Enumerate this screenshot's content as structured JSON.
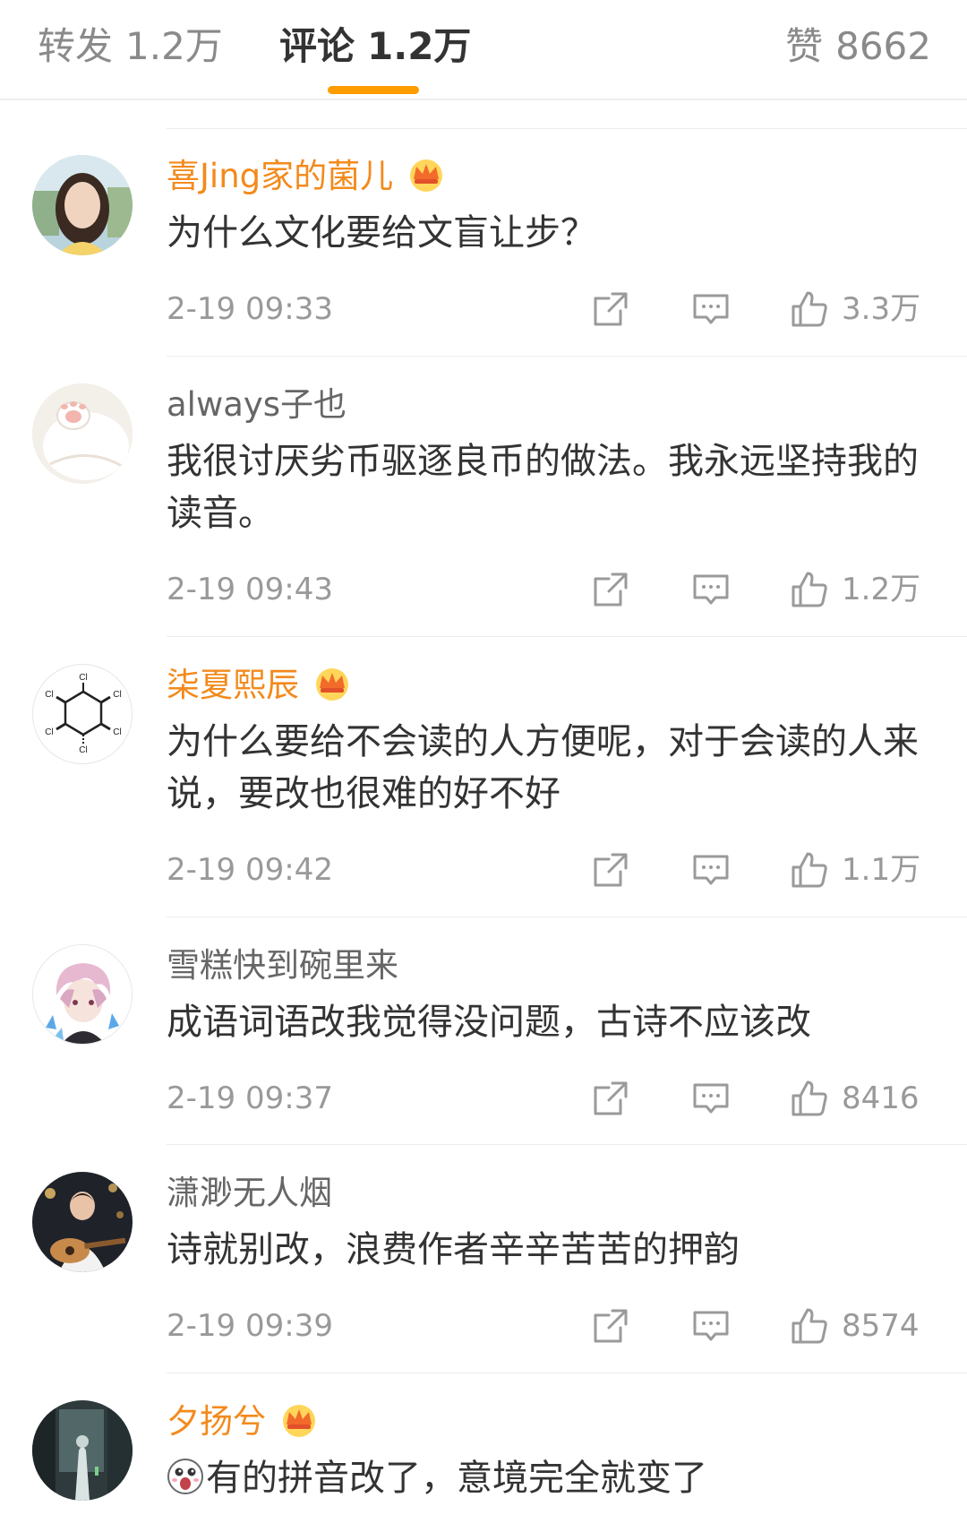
{
  "tabs": {
    "repost": {
      "label": "转发",
      "count": "1.2万"
    },
    "comment": {
      "label": "评论",
      "count": "1.2万"
    },
    "like": {
      "label": "赞",
      "count": "8662"
    }
  },
  "colors": {
    "accent": "#ff9c00",
    "vip_name": "#f38a1c",
    "meta_text": "#999999"
  },
  "comments": [
    {
      "username": "喜Jing家的菌儿",
      "vip": true,
      "text": "为什么文化要给文盲让步？",
      "time": "2-19 09:33",
      "likes": "3.3万",
      "avatar_icon": "avatar-woman-photo"
    },
    {
      "username": "always子也",
      "vip": false,
      "text": "我很讨厌劣币驱逐良币的做法。我永远坚持我的读音。",
      "time": "2-19 09:43",
      "likes": "1.2万",
      "avatar_icon": "avatar-cat-paw"
    },
    {
      "username": "柒夏熙辰",
      "vip": true,
      "text": "为什么要给不会读的人方便呢，对于会读的人来说，要改也很难的好不好",
      "time": "2-19 09:42",
      "likes": "1.1万",
      "avatar_icon": "avatar-chemical-structure"
    },
    {
      "username": "雪糕快到碗里来",
      "vip": false,
      "text": "成语词语改我觉得没问题，古诗不应该改",
      "time": "2-19 09:37",
      "likes": "8416",
      "avatar_icon": "avatar-anime-character"
    },
    {
      "username": "潇渺无人烟",
      "vip": false,
      "text": "诗就别改，浪费作者辛辛苦苦的押韵",
      "time": "2-19 09:39",
      "likes": "8574",
      "avatar_icon": "avatar-guitar-player"
    },
    {
      "username": "夕扬兮",
      "vip": true,
      "text": "有的拼音改了，意境完全就变了",
      "time": "",
      "likes": "",
      "avatar_icon": "avatar-dark-scene",
      "emoji_icon": "shocked-face-emoji"
    }
  ],
  "molecule_labels": {
    "atom": "Cl"
  }
}
